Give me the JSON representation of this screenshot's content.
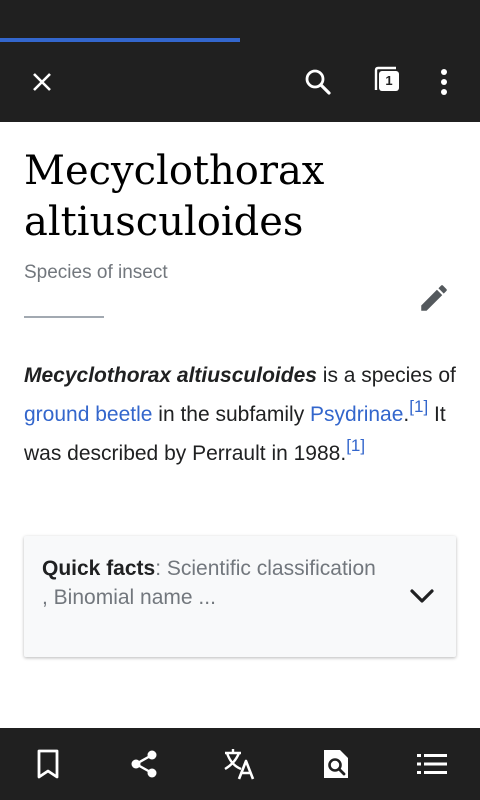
{
  "theme": {
    "bar_color": "#202020",
    "accent": "#3366cc",
    "link": "#3366cc",
    "muted": "#72777d",
    "card_bg": "#f8f9fa"
  },
  "progress": {
    "value": 0.5
  },
  "toolbar": {
    "close_icon": "close-icon",
    "search_icon": "search-icon",
    "tabs_icon": "tabs-icon",
    "tab_count": "1",
    "overflow_icon": "more-vertical-icon"
  },
  "article": {
    "title": "Mecyclothorax altiusculoides",
    "description": "Species of insect",
    "edit_icon": "pencil-icon",
    "paragraph": {
      "bold_name": "Mecyclothorax altiusculoides",
      "text_1": " is a species of ",
      "link_1": "ground beetle",
      "text_2": " in the subfamily ",
      "link_2": "Psydrinae",
      "text_3": ".",
      "ref_1": "[1]",
      "text_4": " It was described by Perrault in 1988.",
      "ref_2": "[1]"
    }
  },
  "quick_facts": {
    "label": "Quick facts",
    "summary": ": Scientific classification , Binomial name ...",
    "chevron_icon": "chevron-down-icon"
  },
  "bottom_bar": {
    "items": [
      {
        "icon": "bookmark-icon"
      },
      {
        "icon": "share-icon"
      },
      {
        "icon": "translate-icon"
      },
      {
        "icon": "find-in-page-icon"
      },
      {
        "icon": "table-of-contents-icon"
      }
    ]
  }
}
